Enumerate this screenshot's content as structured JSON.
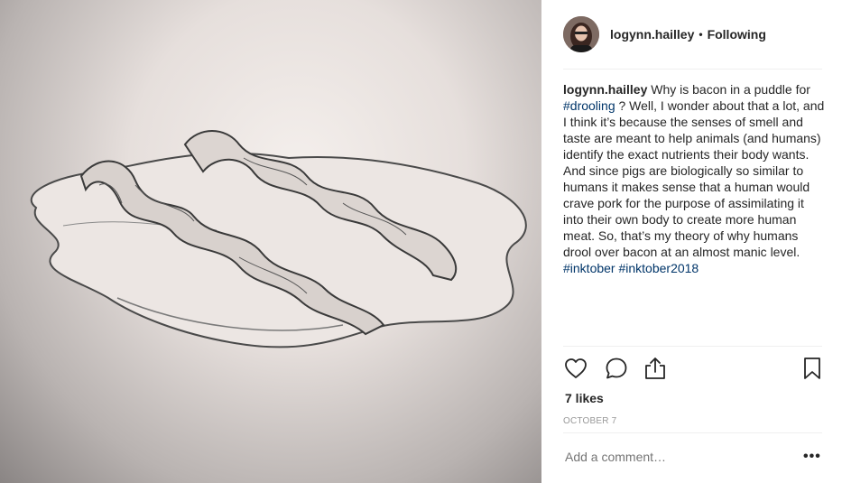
{
  "post": {
    "author": "logynn.hailley",
    "follow_label": "Following",
    "separator": "•",
    "caption": {
      "username": "logynn.hailley",
      "part1": " Why is bacon in a puddle for ",
      "hashtag1": "#drooling",
      "part2": " ? Well, I wonder about that a lot, and I think it’s because the senses of smell and taste are meant to help animals (and humans) identify the exact nutrients their body wants. And since pigs are biologically so similar to humans it makes sense that a human would crave pork for the purpose of assimilating it into their own body to create more human meat. So, that’s my theory of why humans drool over bacon at an almost manic level. ",
      "hashtag2": "#inktober",
      "space": " ",
      "hashtag3": "#inktober2018"
    },
    "likes": "7 likes",
    "date": "OCTOBER 7",
    "comment_placeholder": "Add a comment…",
    "more_label": "•••"
  },
  "icons": {
    "like": "heart-icon",
    "comment": "comment-bubble-icon",
    "share": "share-icon",
    "save": "bookmark-icon"
  },
  "colors": {
    "text": "#262626",
    "hashtag": "#003569",
    "muted": "#999999",
    "divider": "#efefef"
  }
}
